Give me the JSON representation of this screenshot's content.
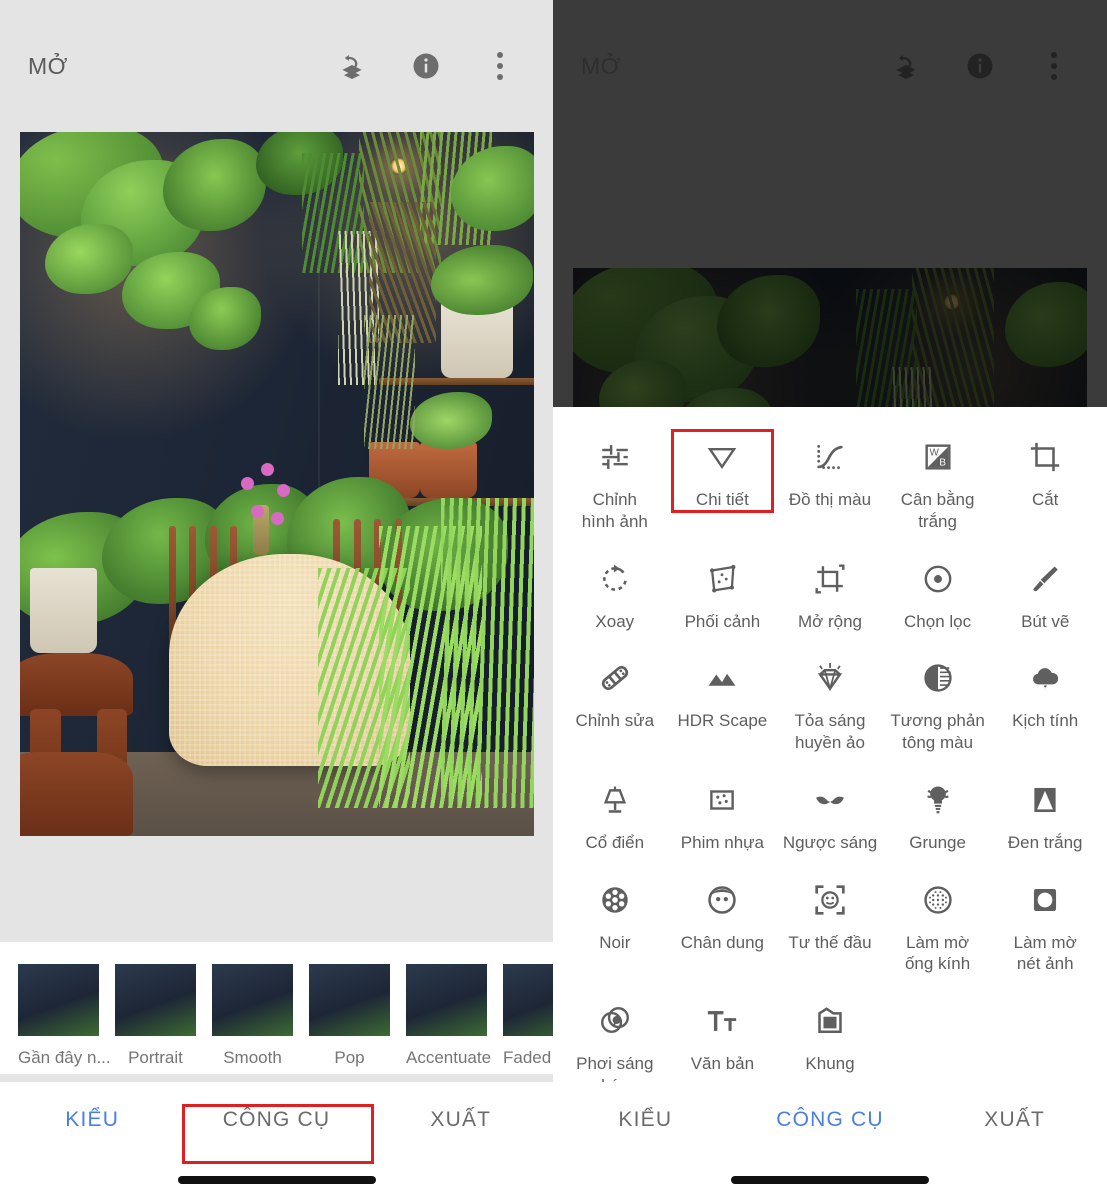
{
  "app": {
    "header": {
      "title": "MỞ"
    },
    "header_icons": [
      {
        "name": "undo-layers-icon",
        "label": "Hoàn tác"
      },
      {
        "name": "info-icon",
        "label": "Thông tin"
      },
      {
        "name": "overflow-menu-icon",
        "label": "Thêm"
      }
    ]
  },
  "left_panel": {
    "header_title": "MỞ",
    "filters": [
      {
        "label": "Gần đây n..."
      },
      {
        "label": "Portrait"
      },
      {
        "label": "Smooth"
      },
      {
        "label": "Pop"
      },
      {
        "label": "Accentuate"
      },
      {
        "label": "Faded Glo"
      }
    ],
    "tabs": [
      {
        "label": "KIỂU",
        "active": true
      },
      {
        "label": "CÔNG CỤ",
        "active": false,
        "highlighted": true
      },
      {
        "label": "XUẤT",
        "active": false
      }
    ]
  },
  "right_panel": {
    "header_title": "MỞ",
    "tools": [
      {
        "label": "Chỉnh\nhình ảnh",
        "icon": "tune-icon"
      },
      {
        "label": "Chi tiết",
        "icon": "details-triangle-icon",
        "highlighted": true
      },
      {
        "label": "Đồ thị màu",
        "icon": "curves-icon"
      },
      {
        "label": "Cân bằng\ntrắng",
        "icon": "white-balance-icon"
      },
      {
        "label": "Cắt",
        "icon": "crop-icon"
      },
      {
        "label": "Xoay",
        "icon": "rotate-icon"
      },
      {
        "label": "Phối cảnh",
        "icon": "perspective-icon"
      },
      {
        "label": "Mở rộng",
        "icon": "expand-icon"
      },
      {
        "label": "Chọn lọc",
        "icon": "selective-icon"
      },
      {
        "label": "Bút vẽ",
        "icon": "brush-icon"
      },
      {
        "label": "Chỉnh sửa",
        "icon": "healing-icon"
      },
      {
        "label": "HDR Scape",
        "icon": "hdr-mountains-icon"
      },
      {
        "label": "Tỏa sáng\nhuyền ảo",
        "icon": "glamour-glow-icon"
      },
      {
        "label": "Tương phản\ntông màu",
        "icon": "tonal-contrast-icon"
      },
      {
        "label": "Kịch tính",
        "icon": "drama-cloud-icon"
      },
      {
        "label": "Cổ điển",
        "icon": "vintage-lamp-icon"
      },
      {
        "label": "Phim nhựa",
        "icon": "grainy-film-icon"
      },
      {
        "label": "Ngược sáng",
        "icon": "retrolux-mustache-icon"
      },
      {
        "label": "Grunge",
        "icon": "grunge-icon"
      },
      {
        "label": "Đen trắng",
        "icon": "black-white-icon"
      },
      {
        "label": "Noir",
        "icon": "noir-reel-icon"
      },
      {
        "label": "Chân dung",
        "icon": "portrait-face-icon"
      },
      {
        "label": "Tư thế đầu",
        "icon": "head-pose-icon"
      },
      {
        "label": "Làm mờ\nống kính",
        "icon": "lens-blur-icon"
      },
      {
        "label": "Làm mờ\nnét ảnh",
        "icon": "vignette-icon"
      },
      {
        "label": "Phơi sáng\nkép",
        "icon": "double-exposure-icon"
      },
      {
        "label": "Văn bản",
        "icon": "text-icon"
      },
      {
        "label": "Khung",
        "icon": "frames-icon"
      }
    ],
    "tabs": [
      {
        "label": "KIỂU",
        "active": false
      },
      {
        "label": "CÔNG CỤ",
        "active": true
      },
      {
        "label": "XUẤT",
        "active": false
      }
    ]
  },
  "colors": {
    "accent_blue": "#4a7fe0",
    "highlight_red": "#e02020",
    "left_bg": "#e4e4e4",
    "right_bg": "#3b3b3b",
    "sheet_bg": "#ffffff",
    "icon_gray": "#5f5f5f"
  }
}
